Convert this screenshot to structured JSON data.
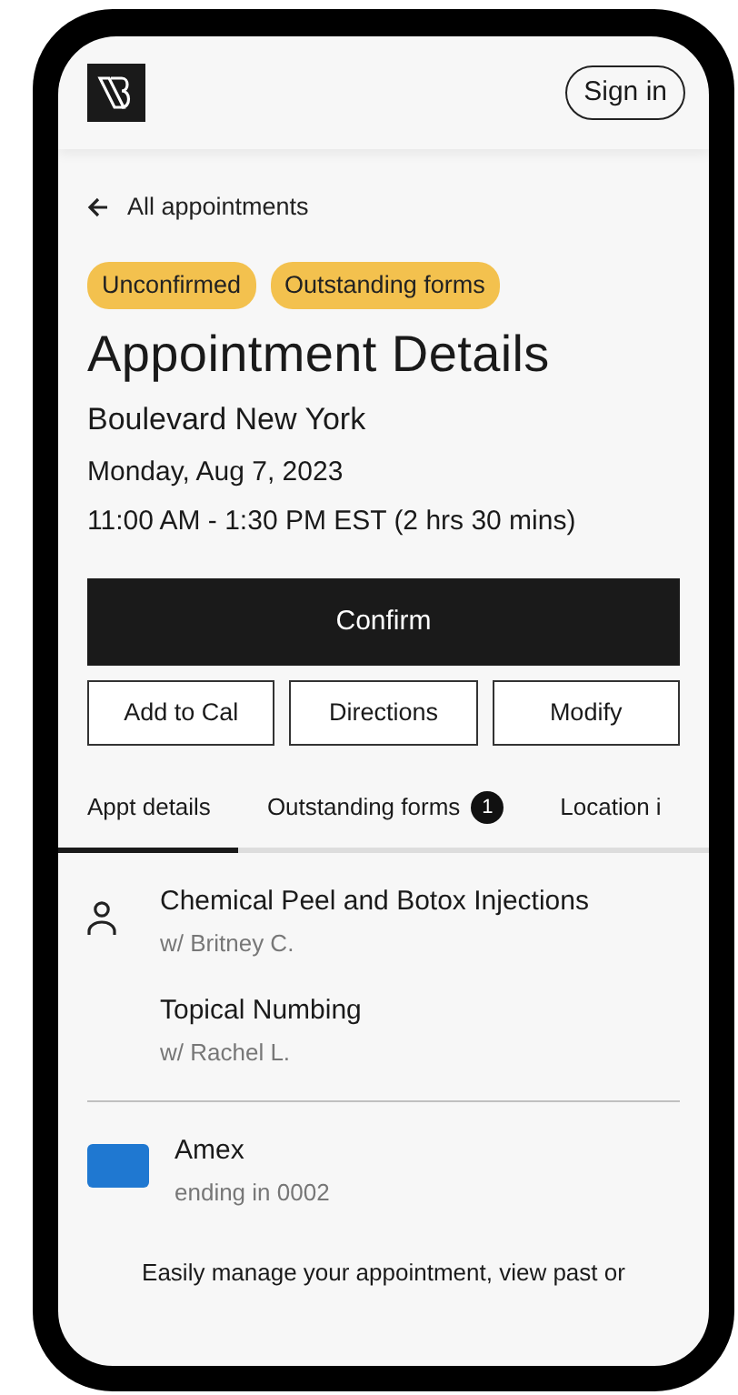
{
  "header": {
    "sign_in": "Sign in"
  },
  "back_link": "All appointments",
  "badges": [
    "Unconfirmed",
    "Outstanding forms"
  ],
  "title": "Appointment Details",
  "location": "Boulevard New York",
  "date": "Monday, Aug 7, 2023",
  "time": "11:00 AM - 1:30 PM EST (2 hrs 30 mins)",
  "primary_button": "Confirm",
  "buttons": [
    "Add to Cal",
    "Directions",
    "Modify"
  ],
  "tabs": [
    {
      "label": "Appt details",
      "selected": true
    },
    {
      "label": "Outstanding forms",
      "selected": false,
      "badge": "1"
    },
    {
      "label": "Location i",
      "selected": false
    }
  ],
  "services": [
    {
      "name": "Chemical Peel and Botox Injections",
      "provider": "w/ Britney C."
    },
    {
      "name": "Topical Numbing",
      "provider": "w/ Rachel L."
    }
  ],
  "payment": {
    "name": "Amex",
    "detail": "ending in 0002"
  },
  "footer_text": "Easily manage your appointment, view past or"
}
